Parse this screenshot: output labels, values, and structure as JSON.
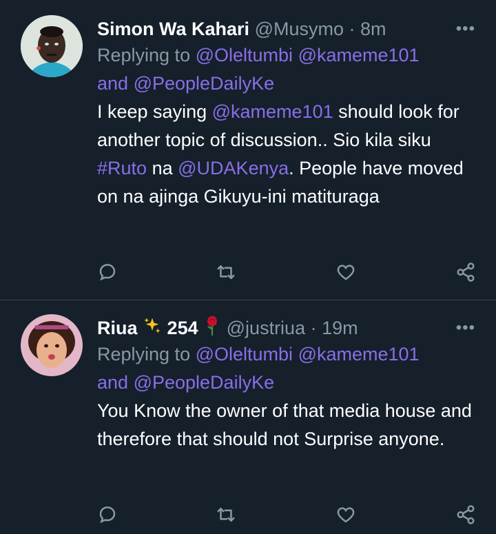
{
  "tweets": [
    {
      "name": "Simon Wa Kahari",
      "handle": "@Musymo",
      "time": "8m",
      "more": "•••",
      "replying_prefix": "Replying to",
      "replying_to": [
        "@Oleltumbi",
        "@kameme101"
      ],
      "replying_and": "and",
      "replying_last": "@PeopleDailyKe",
      "text": {
        "p1": "I keep saying",
        "m1": "@kameme101",
        "p2": "should look for another topic of discussion.. Sio kila siku",
        "m2": "#Ruto",
        "p3": "na",
        "m3": "@UDAKenya",
        "p4": ". People have moved on na ajinga Gikuyu-ini matituraga"
      }
    },
    {
      "name_part1": "Riua",
      "name_part2": "254",
      "handle": "@justriua",
      "time": "19m",
      "more": "•••",
      "replying_prefix": "Replying to",
      "replying_to": [
        "@Oleltumbi",
        "@kameme101"
      ],
      "replying_and": "and",
      "replying_last": "@PeopleDailyKe",
      "text": "You Know the owner of that media house and therefore that should not Surprise anyone."
    }
  ],
  "colors": {
    "background": "#15202b",
    "muted": "#8899a6",
    "link": "#8a6ee8",
    "divider": "#38444d"
  },
  "icons": [
    "reply-icon",
    "retweet-icon",
    "like-icon",
    "share-icon",
    "sparkles-icon",
    "rose-icon",
    "more-icon"
  ]
}
